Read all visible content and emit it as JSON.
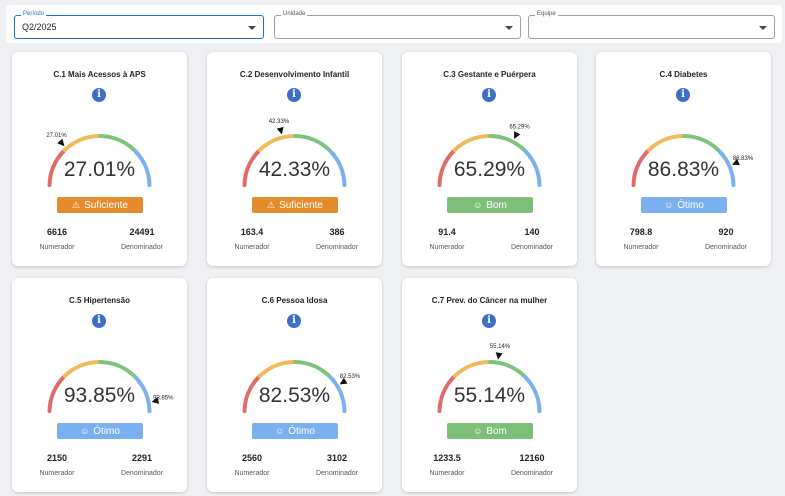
{
  "filters": [
    {
      "label": "Período",
      "value": "Q2/2025",
      "active": true
    },
    {
      "label": "Unidade",
      "value": "",
      "active": false
    },
    {
      "label": "Equipe",
      "value": "",
      "active": false
    }
  ],
  "statusColors": {
    "Suficiente": "#e48c2c",
    "Bom": "#7dbf78",
    "Ótimo": "#7aaff0"
  },
  "statusIcons": {
    "Suficiente": "warning-icon",
    "Bom": "smiley-icon",
    "Ótimo": "smiley-icon"
  },
  "cards": [
    {
      "title": "C.1 Mais Acessos à APS",
      "value": 27.01,
      "value_label": "27.01%",
      "status": "Suficiente",
      "numerador": "6616",
      "denominador": "24491",
      "numerador_label": "Numerador",
      "denominador_label": "Denominador"
    },
    {
      "title": "C.2 Desenvolvimento Infantil",
      "value": 42.33,
      "value_label": "42.33%",
      "status": "Suficiente",
      "numerador": "163.4",
      "denominador": "386",
      "numerador_label": "Numerador",
      "denominador_label": "Denominador"
    },
    {
      "title": "C.3 Gestante e Puérpera",
      "value": 65.29,
      "value_label": "65.29%",
      "status": "Bom",
      "numerador": "91.4",
      "denominador": "140",
      "numerador_label": "Numerador",
      "denominador_label": "Denominador"
    },
    {
      "title": "C.4 Diabetes",
      "value": 86.83,
      "value_label": "86.83%",
      "status": "Ótimo",
      "numerador": "798.8",
      "denominador": "920",
      "numerador_label": "Numerador",
      "denominador_label": "Denominador"
    },
    {
      "title": "C.5 Hipertensão",
      "value": 93.85,
      "value_label": "93.85%",
      "status": "Ótimo",
      "numerador": "2150",
      "denominador": "2291",
      "numerador_label": "Numerador",
      "denominador_label": "Denominador"
    },
    {
      "title": "C.6 Pessoa Idosa",
      "value": 82.53,
      "value_label": "82.53%",
      "status": "Ótimo",
      "numerador": "2560",
      "denominador": "3102",
      "numerador_label": "Numerador",
      "denominador_label": "Denominador"
    },
    {
      "title": "C.7 Prev. do Câncer na mulher",
      "value": 55.14,
      "value_label": "55.14%",
      "status": "Bom",
      "numerador": "1233.5",
      "denominador": "12160",
      "numerador_label": "Numerador",
      "denominador_label": "Denominador"
    }
  ]
}
